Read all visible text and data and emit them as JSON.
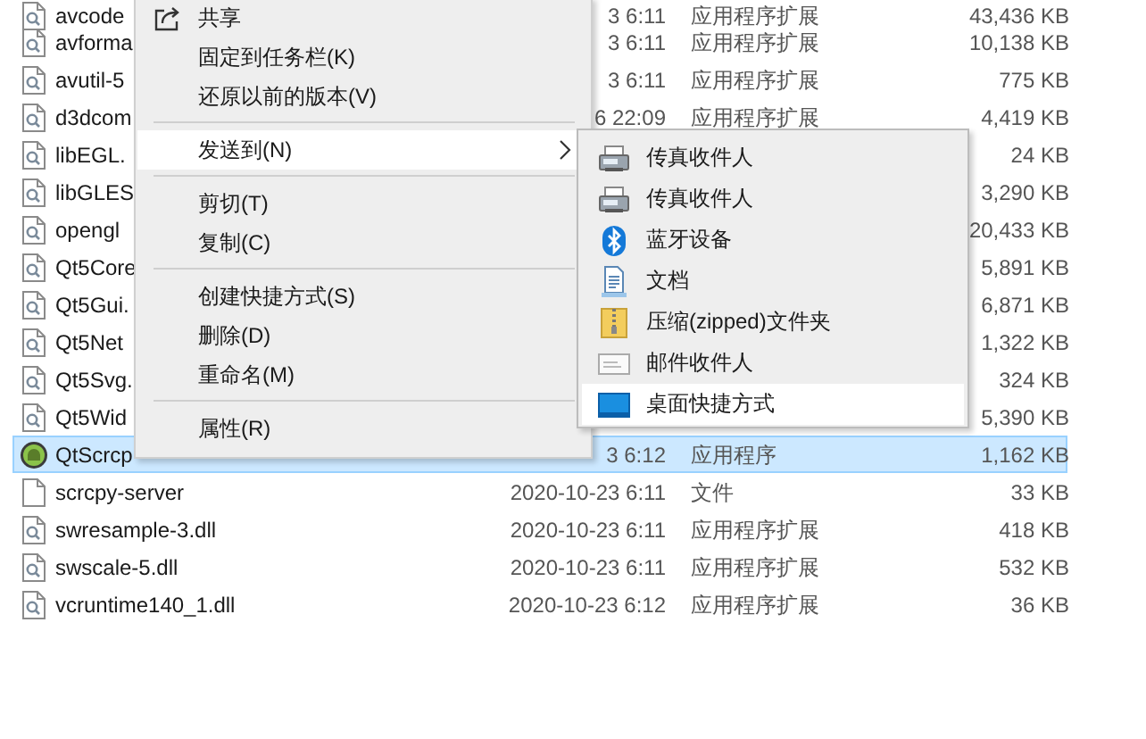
{
  "files": [
    {
      "name": "avcode",
      "date": "3 6:11",
      "type": "应用程序扩展",
      "size": "43,436 KB",
      "kind": "dll",
      "selected": false
    },
    {
      "name": "avforma",
      "date": "3 6:11",
      "type": "应用程序扩展",
      "size": "10,138 KB",
      "kind": "dll",
      "selected": false
    },
    {
      "name": "avutil-5",
      "date": "3 6:11",
      "type": "应用程序扩展",
      "size": "775 KB",
      "kind": "dll",
      "selected": false
    },
    {
      "name": "d3dcom",
      "date": "6 22:09",
      "type": "应用程序扩展",
      "size": "4,419 KB",
      "kind": "dll",
      "selected": false
    },
    {
      "name": "libEGL.",
      "size": "24 KB",
      "kind": "dll",
      "selected": false
    },
    {
      "name": "libGLES",
      "size": "3,290 KB",
      "kind": "dll",
      "selected": false
    },
    {
      "name": "opengl",
      "size": "20,433 KB",
      "kind": "dll",
      "selected": false
    },
    {
      "name": "Qt5Core",
      "size": "5,891 KB",
      "kind": "dll",
      "selected": false
    },
    {
      "name": "Qt5Gui.",
      "size": "6,871 KB",
      "kind": "dll",
      "selected": false
    },
    {
      "name": "Qt5Net",
      "size": "1,322 KB",
      "kind": "dll",
      "selected": false
    },
    {
      "name": "Qt5Svg.",
      "size": "324 KB",
      "kind": "dll",
      "selected": false
    },
    {
      "name": "Qt5Wid",
      "size": "5,390 KB",
      "kind": "dll",
      "selected": false
    },
    {
      "name": "QtScrcp",
      "date": "3 6:12",
      "type": "应用程序",
      "size": "1,162 KB",
      "kind": "app",
      "selected": true
    },
    {
      "name": "scrcpy-server",
      "date": "2020-10-23 6:11",
      "type": "文件",
      "size": "33 KB",
      "kind": "file",
      "selected": false
    },
    {
      "name": "swresample-3.dll",
      "date": "2020-10-23 6:11",
      "type": "应用程序扩展",
      "size": "418 KB",
      "kind": "dll",
      "selected": false
    },
    {
      "name": "swscale-5.dll",
      "date": "2020-10-23 6:11",
      "type": "应用程序扩展",
      "size": "532 KB",
      "kind": "dll",
      "selected": false
    },
    {
      "name": "vcruntime140_1.dll",
      "date": "2020-10-23 6:12",
      "type": "应用程序扩展",
      "size": "36 KB",
      "kind": "dll",
      "selected": false
    }
  ],
  "context_menu": [
    {
      "kind": "share",
      "label": "共享",
      "selected": false
    },
    {
      "kind": "item",
      "label": "固定到任务栏(K)",
      "selected": false
    },
    {
      "kind": "item",
      "label": "还原以前的版本(V)",
      "selected": false
    },
    {
      "kind": "separator"
    },
    {
      "kind": "item",
      "label": "发送到(N)",
      "submenu": true,
      "selected": true
    },
    {
      "kind": "separator"
    },
    {
      "kind": "item",
      "label": "剪切(T)",
      "selected": false
    },
    {
      "kind": "item",
      "label": "复制(C)",
      "selected": false
    },
    {
      "kind": "separator"
    },
    {
      "kind": "item",
      "label": "创建快捷方式(S)",
      "selected": false
    },
    {
      "kind": "item",
      "label": "删除(D)",
      "selected": false
    },
    {
      "kind": "item",
      "label": "重命名(M)",
      "selected": false
    },
    {
      "kind": "separator"
    },
    {
      "kind": "item",
      "label": "属性(R)",
      "selected": false
    }
  ],
  "send_to_menu": [
    {
      "label": "传真收件人",
      "kind": "fax",
      "selected": false
    },
    {
      "label": "传真收件人",
      "kind": "fax",
      "selected": false
    },
    {
      "label": "蓝牙设备",
      "kind": "bluetooth",
      "selected": false
    },
    {
      "label": "文档",
      "kind": "document",
      "selected": false
    },
    {
      "label": "压缩(zipped)文件夹",
      "kind": "zip",
      "selected": false
    },
    {
      "label": "邮件收件人",
      "kind": "mail",
      "selected": false
    },
    {
      "label": "桌面快捷方式",
      "kind": "desktop",
      "selected": true
    }
  ]
}
